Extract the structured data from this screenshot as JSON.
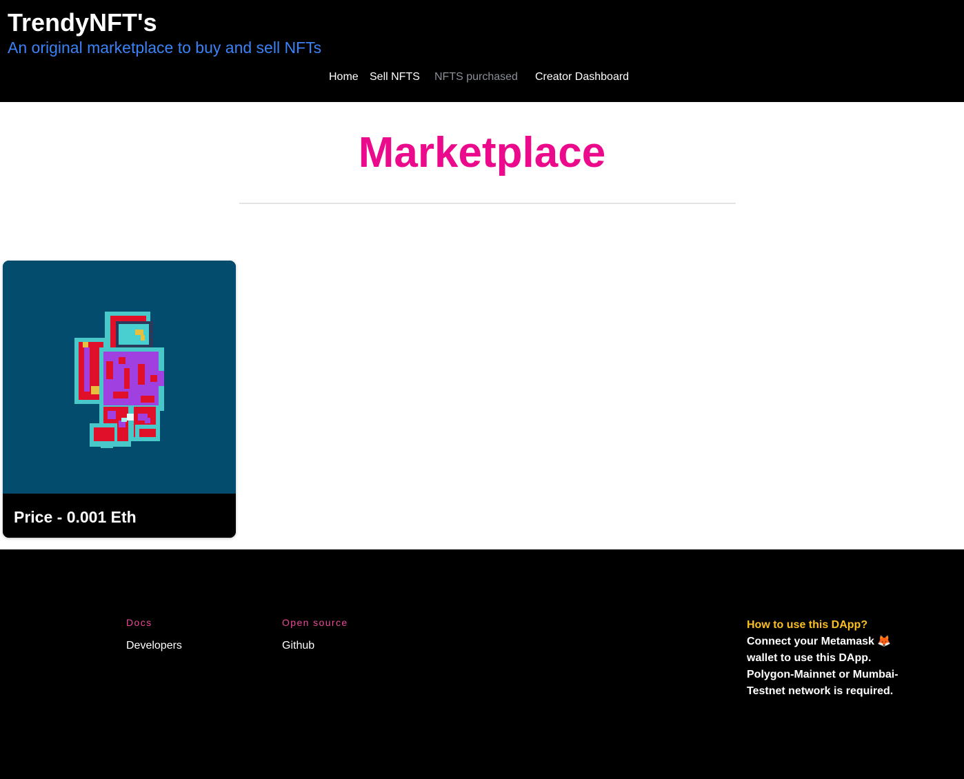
{
  "header": {
    "title": "TrendyNFT's",
    "subtitle": "An original marketplace to buy and sell NFTs"
  },
  "nav": {
    "home": "Home",
    "sell": "Sell NFTS",
    "purchased": "NFTS purchased",
    "dashboard": "Creator Dashboard"
  },
  "main": {
    "title": "Marketplace",
    "cards": [
      {
        "price": "Price - 0.001 Eth",
        "image_icon": "pixel-astronaut-icon"
      }
    ]
  },
  "footer": {
    "docs_heading": "Docs",
    "docs_link": "Developers",
    "opensource_heading": "Open source",
    "opensource_link": "Github",
    "howto_title": "How to use this DApp?",
    "howto_body": "Connect your Metamask 🦊 wallet to use this DApp. Polygon-Mainnet or Mumbai-Testnet network is required."
  },
  "colors": {
    "accent_pink": "#ec0a8c",
    "subtitle_blue": "#3b82f6",
    "howto_yellow": "#fbbf24",
    "nft_background": "#034c6e"
  }
}
